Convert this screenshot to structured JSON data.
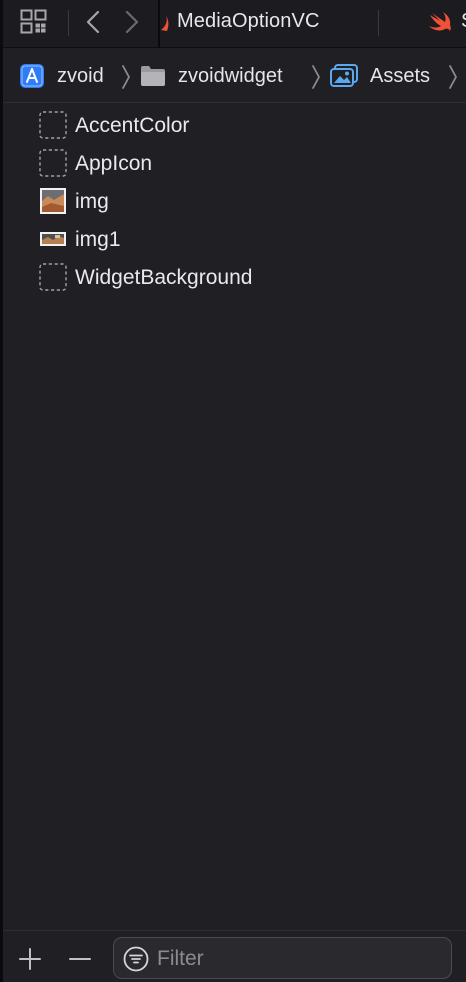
{
  "tabbar": {
    "active_tab_title": "MediaOptionVC",
    "next_tab_cut_text": "S",
    "icons": {
      "related": "grid-icon",
      "back": "chevron-left-icon",
      "forward": "chevron-right-icon",
      "file_type": "swift-icon"
    }
  },
  "breadcrumb": {
    "items": [
      {
        "label": "zvoid",
        "icon": "app-project-icon"
      },
      {
        "label": "zvoidwidget",
        "icon": "folder-icon"
      },
      {
        "label": "Assets",
        "icon": "asset-catalog-icon"
      }
    ]
  },
  "assets": [
    {
      "name": "AccentColor",
      "thumb": "placeholder"
    },
    {
      "name": "AppIcon",
      "thumb": "placeholder"
    },
    {
      "name": "img",
      "thumb": "image"
    },
    {
      "name": "img1",
      "thumb": "wide-image"
    },
    {
      "name": "WidgetBackground",
      "thumb": "placeholder"
    }
  ],
  "bottombar": {
    "filter_placeholder": "Filter",
    "filter_value": ""
  },
  "colors": {
    "background": "#1f1f24",
    "tabbar": "#1c1c20",
    "swift_orange": "#f05138",
    "project_blue": "#2f7cf6",
    "text": "#e6e6e8",
    "placeholder_text": "#8b8b91"
  }
}
